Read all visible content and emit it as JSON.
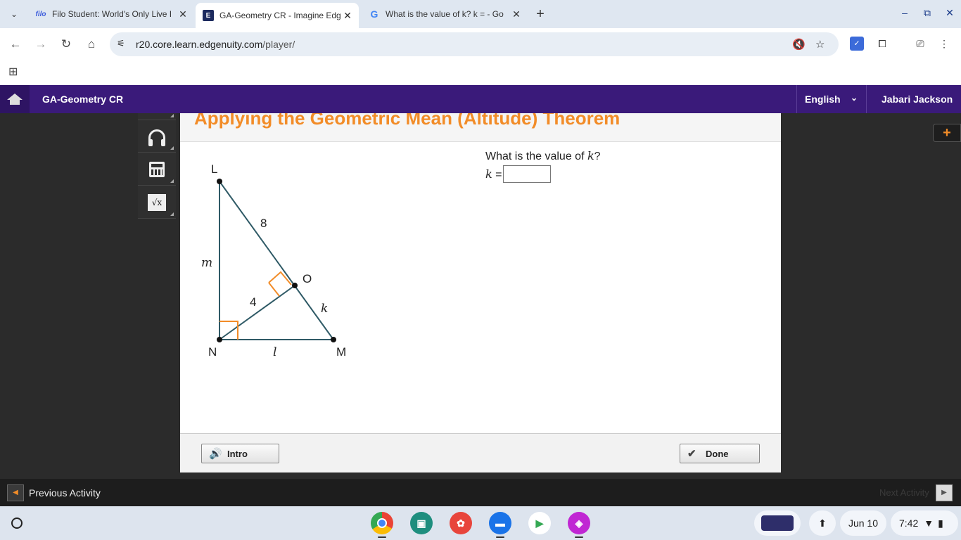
{
  "browser": {
    "tabs": [
      {
        "favicon": "filo",
        "title": "Filo Student: World's Only Live I"
      },
      {
        "favicon": "E",
        "title": "GA-Geometry CR - Imagine Edg"
      },
      {
        "favicon": "G",
        "title": "What is the value of k? k = - Go"
      }
    ],
    "url_host": "r20.core.learn.edgenuity.com",
    "url_path": "/player/"
  },
  "app": {
    "course_title": "GA-Geometry CR",
    "language": "English",
    "user_name": "Jabari Jackson"
  },
  "lesson": {
    "title": "Applying the Geometric Mean (Altitude) Theorem",
    "question_prefix": "What is the value of ",
    "question_var": "k",
    "question_suffix": "?",
    "answer_var": "k",
    "answer_eq": " =",
    "answer_value": ""
  },
  "figure": {
    "vertices": {
      "L": "L",
      "N": "N",
      "M": "M",
      "O": "O"
    },
    "labels": {
      "LO": "8",
      "NO": "4",
      "OM": "k",
      "LN": "m",
      "NM": "l"
    }
  },
  "footer": {
    "intro_label": "Intro",
    "done_label": "Done"
  },
  "activity": {
    "prev_label": "Previous Activity",
    "next_label": "Next Activity"
  },
  "shelf": {
    "date": "Jun 10",
    "time": "7:42"
  },
  "colors": {
    "header": "#3a1a7a",
    "accent": "#f28c28",
    "figure_line": "#2f5a66"
  }
}
